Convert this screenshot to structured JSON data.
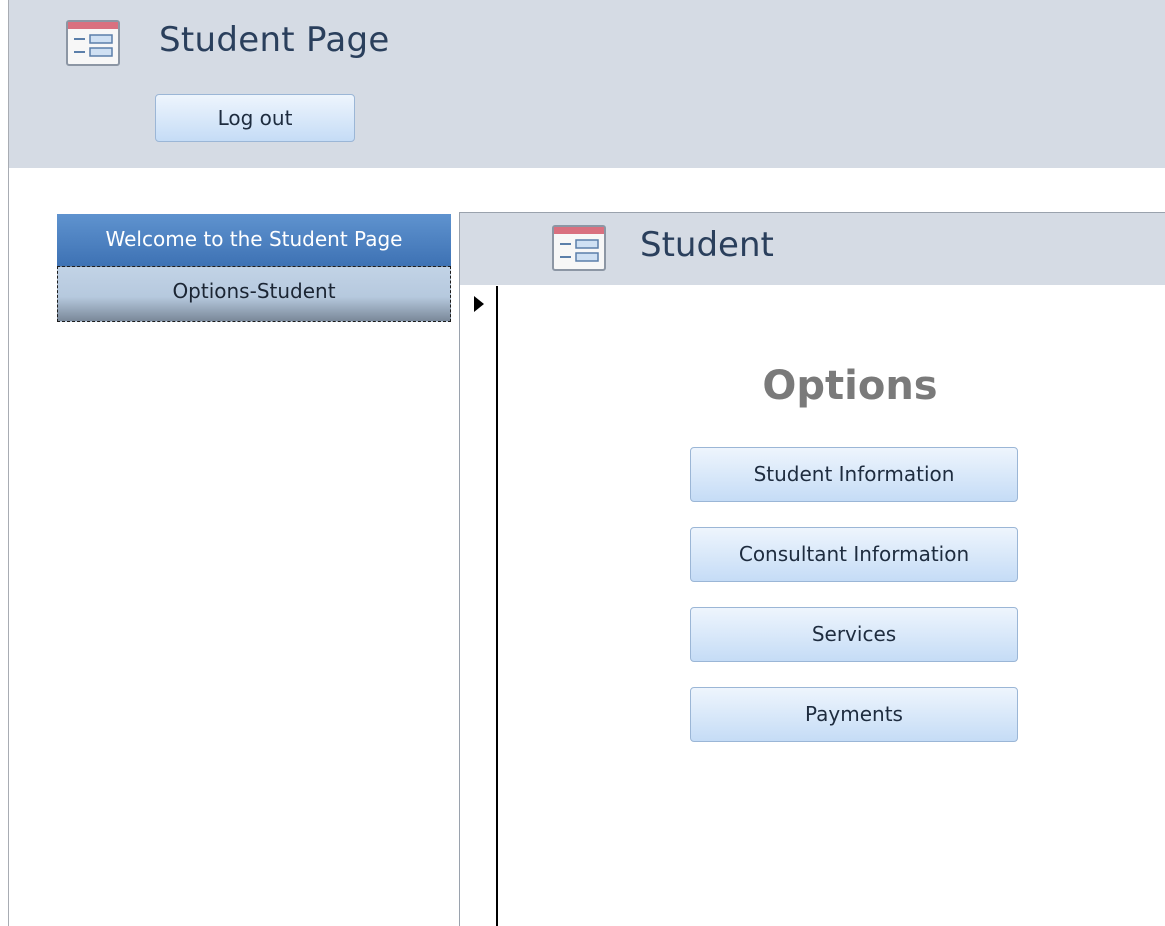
{
  "header": {
    "title": "Student Page",
    "logout_label": "Log out",
    "icon": "form-icon"
  },
  "navigation": {
    "header": "Welcome to the Student Page",
    "items": [
      {
        "label": "Options-Student"
      }
    ]
  },
  "subform": {
    "title": "Student",
    "icon": "form-icon",
    "options_label": "Options",
    "buttons": [
      {
        "label": "Student Information"
      },
      {
        "label": "Consultant Information"
      },
      {
        "label": "Services"
      },
      {
        "label": "Payments"
      }
    ]
  },
  "colors": {
    "header_bg": "#d5dbe4",
    "nav_header_bg": "#4a7ec0",
    "button_bg": "#c5dcf6",
    "title_text": "#2a3f5c"
  }
}
